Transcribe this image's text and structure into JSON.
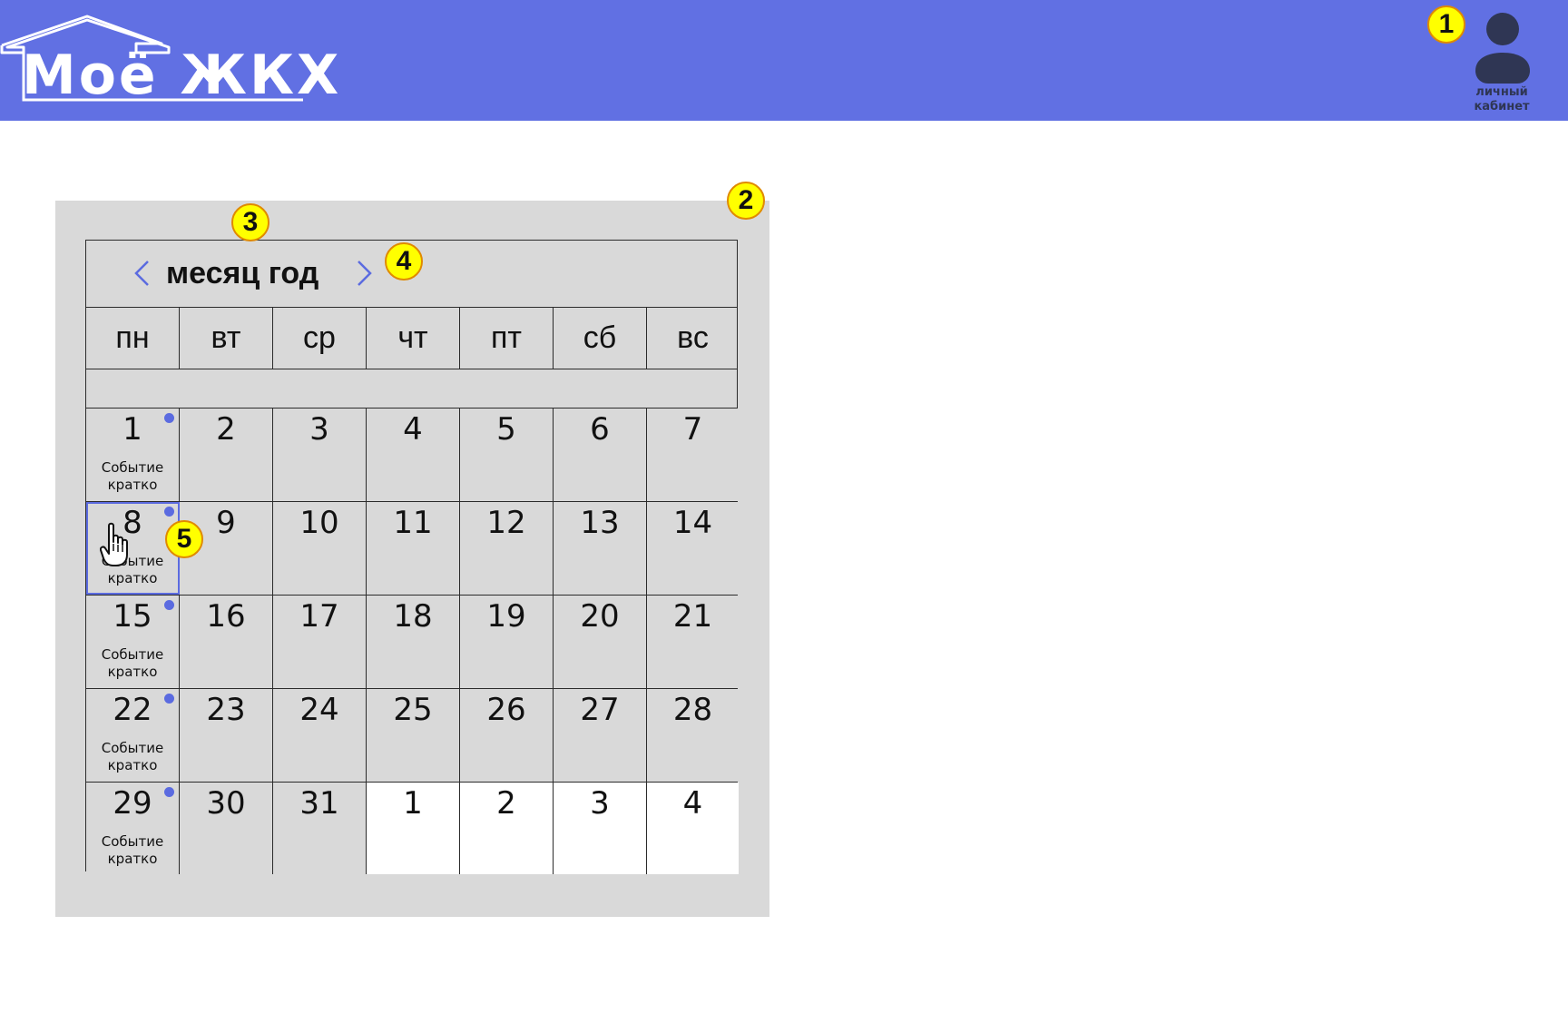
{
  "header": {
    "logo_text": "Моё ЖКХ",
    "profile_label": "личный кабинет",
    "icons": {
      "logo": "house-roof-icon",
      "profile": "user-avatar-icon"
    }
  },
  "colors": {
    "header_bg": "#6170e3",
    "panel_bg": "#d9d9d9",
    "accent": "#5b6be0",
    "marker": "#ffff00",
    "profile_icon": "#2f3654"
  },
  "markers": [
    "1",
    "2",
    "3",
    "4",
    "5"
  ],
  "calendar": {
    "title": "месяц год",
    "prev_icon": "chevron-left-icon",
    "next_icon": "chevron-right-icon",
    "weekdays": [
      "пн",
      "вт",
      "ср",
      "чт",
      "пт",
      "сб",
      "вс"
    ],
    "weeks": [
      [
        {
          "day": "1",
          "event": "Событие\nкратко",
          "dot": true
        },
        {
          "day": "2"
        },
        {
          "day": "3"
        },
        {
          "day": "4"
        },
        {
          "day": "5"
        },
        {
          "day": "6"
        },
        {
          "day": "7"
        }
      ],
      [
        {
          "day": "8",
          "event": "Событие\nкратко",
          "dot": true,
          "selected": true
        },
        {
          "day": "9"
        },
        {
          "day": "10"
        },
        {
          "day": "11"
        },
        {
          "day": "12"
        },
        {
          "day": "13"
        },
        {
          "day": "14"
        }
      ],
      [
        {
          "day": "15",
          "event": "Событие\nкратко",
          "dot": true
        },
        {
          "day": "16"
        },
        {
          "day": "17"
        },
        {
          "day": "18"
        },
        {
          "day": "19"
        },
        {
          "day": "20"
        },
        {
          "day": "21"
        }
      ],
      [
        {
          "day": "22",
          "event": "Событие\nкратко",
          "dot": true
        },
        {
          "day": "23"
        },
        {
          "day": "24"
        },
        {
          "day": "25"
        },
        {
          "day": "26"
        },
        {
          "day": "27"
        },
        {
          "day": "28"
        }
      ],
      [
        {
          "day": "29",
          "event": "Событие\nкратко",
          "dot": true
        },
        {
          "day": "30"
        },
        {
          "day": "31"
        },
        {
          "day": "1",
          "other_month": true
        },
        {
          "day": "2",
          "other_month": true
        },
        {
          "day": "3",
          "other_month": true
        },
        {
          "day": "4",
          "other_month": true
        }
      ]
    ]
  },
  "cursor_icon": "hand-pointer-icon"
}
